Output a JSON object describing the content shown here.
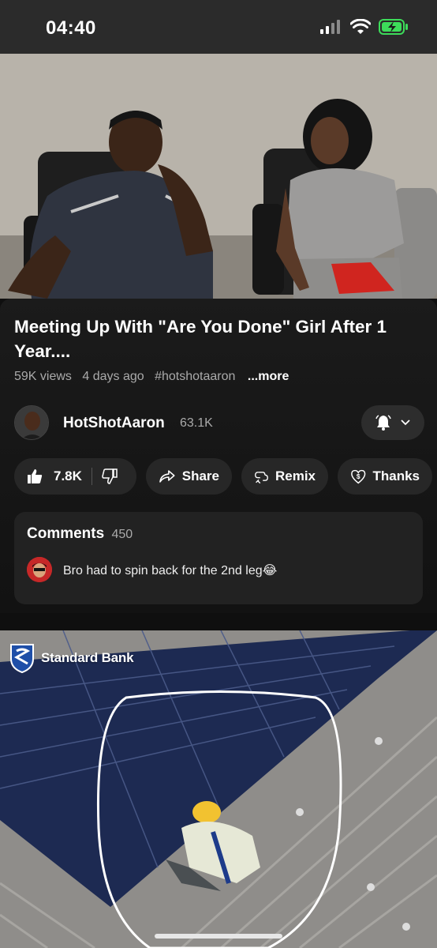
{
  "status_bar": {
    "time": "04:40"
  },
  "video": {
    "title": "Meeting Up With \"Are You Done\" Girl After 1 Year....",
    "views": "59K views",
    "age": "4 days ago",
    "hashtag": "#hotshotaaron",
    "more_label": "...more"
  },
  "channel": {
    "name": "HotShotAaron",
    "subscribers": "63.1K"
  },
  "actions": {
    "likes": "7.8K",
    "share_label": "Share",
    "remix_label": "Remix",
    "thanks_label": "Thanks"
  },
  "comments": {
    "heading": "Comments",
    "count": "450",
    "top_comment": "Bro had to spin back for the 2nd leg😂"
  },
  "ad": {
    "brand": "Standard Bank"
  },
  "colors": {
    "background": "#0f0f0f",
    "pill": "#272727",
    "accent_green": "#3ddc5a"
  }
}
